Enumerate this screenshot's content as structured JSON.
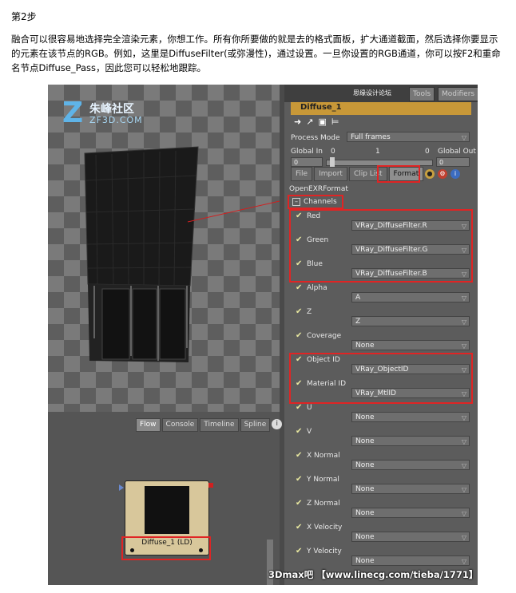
{
  "article": {
    "step": "第2步",
    "paragraph": "融合可以很容易地选择完全渲染元素，你想工作。所有你所要做的就是去的格式面板，扩大通道截面，然后选择你要显示的元素在该节点的RGB。例如，这里是DiffuseFilter(或弥漫性)，通过设置。一旦你设置的RGB通道，你可以按F2和重命名节点Diffuse_Pass，因此您可以轻松地跟踪。"
  },
  "logo": {
    "mark": "Z",
    "cn": "朱峰社区",
    "en": "ZF3D.COM"
  },
  "flow": {
    "tabs": [
      "Flow",
      "Console",
      "Timeline",
      "Spline"
    ],
    "info": "i",
    "node_label": "Diffuse_1  (LD)"
  },
  "inspector": {
    "site_cn": "思缘设计论坛",
    "tabs": [
      "Tools",
      "Modifiers"
    ],
    "title": "Diffuse_1",
    "process_mode_label": "Process Mode",
    "process_mode_value": "Full frames",
    "global_in_label": "Global In",
    "global_out_label": "Global Out",
    "range_start": "0",
    "range_mid": "1",
    "range_end": "0",
    "global_in_value": "0",
    "global_out_value": "0",
    "format_tabs": [
      "File",
      "Import",
      "Clip List",
      "Format"
    ],
    "format_name": "OpenEXRFormat",
    "channels_label": "Channels",
    "channels": [
      {
        "name": "Red",
        "value": "VRay_DiffuseFilter.R"
      },
      {
        "name": "Green",
        "value": "VRay_DiffuseFilter.G"
      },
      {
        "name": "Blue",
        "value": "VRay_DiffuseFilter.B"
      },
      {
        "name": "Alpha",
        "value": "A"
      },
      {
        "name": "Z",
        "value": "Z"
      },
      {
        "name": "Coverage",
        "value": "None"
      },
      {
        "name": "Object ID",
        "value": "VRay_ObjectID"
      },
      {
        "name": "Material ID",
        "value": "VRay_MtlID"
      },
      {
        "name": "U",
        "value": "None"
      },
      {
        "name": "V",
        "value": "None"
      },
      {
        "name": "X Normal",
        "value": "None"
      },
      {
        "name": "Y Normal",
        "value": "None"
      },
      {
        "name": "Z Normal",
        "value": "None"
      },
      {
        "name": "X Velocity",
        "value": "None"
      },
      {
        "name": "Y Velocity",
        "value": "None"
      }
    ]
  },
  "watermark": "3Dmax吧 【www.linecg.com/tieba/1771】",
  "colors": {
    "highlight": "#e02424",
    "title_bar": "#c89838",
    "node": "#d8c79b",
    "logo": "#5fb4e8"
  }
}
